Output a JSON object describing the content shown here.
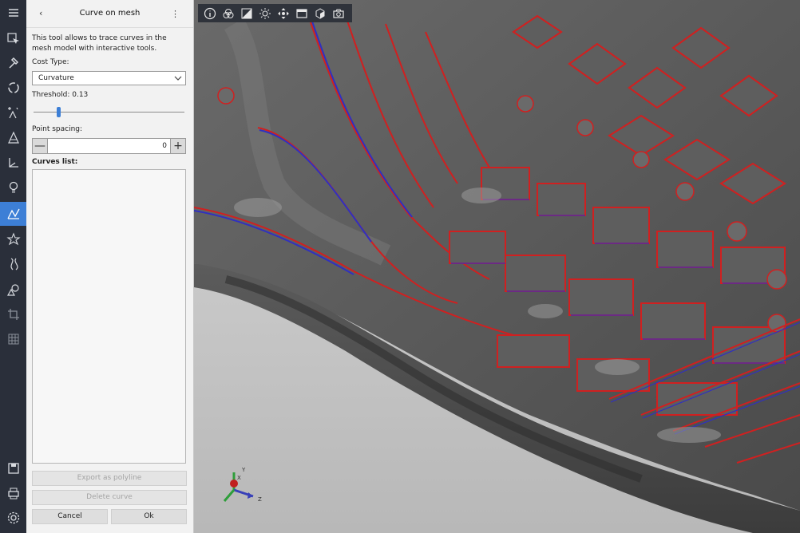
{
  "panel": {
    "title": "Curve on mesh",
    "back": "‹",
    "menu": "⋮",
    "description": "This tool allows to trace curves in the mesh model with interactive tools.",
    "cost_type_label": "Cost Type:",
    "cost_type_value": "Curvature",
    "threshold_label": "Threshold: 0.13",
    "threshold_value": 0.13,
    "point_spacing_label": "Point spacing:",
    "point_spacing_value": "0",
    "minus": "—",
    "plus": "+",
    "curves_list_label": "Curves list:",
    "curves": [],
    "export_label": "Export as polyline",
    "delete_label": "Delete curve",
    "cancel_label": "Cancel",
    "ok_label": "Ok"
  },
  "toolbar": {
    "icons": [
      "menu-icon",
      "select-cursor-icon",
      "hammer-icon",
      "recycle-icon",
      "sparkle-icon",
      "cone-icon",
      "axis-icon",
      "lightbulb-icon",
      "curve-mesh-icon",
      "star-mesh-icon",
      "ribbon-icon",
      "shapes-icon",
      "crop-icon",
      "grid-icon",
      "save-icon",
      "printer-icon",
      "settings-icon"
    ],
    "active": "curve-mesh-icon"
  },
  "view_toolbar": {
    "icons": [
      "info-icon",
      "color-wheel-icon",
      "contrast-icon",
      "light-icon",
      "move-icon",
      "window-icon",
      "cube-icon",
      "camera-icon"
    ]
  },
  "axis": {
    "x_label": "X",
    "y_label": "Y",
    "z_label": "Z"
  },
  "colors": {
    "accent": "#3d7fd6",
    "toolbar_bg": "#2a2f3a",
    "curve_red": "#d02020",
    "curve_blue": "#3030c0"
  }
}
